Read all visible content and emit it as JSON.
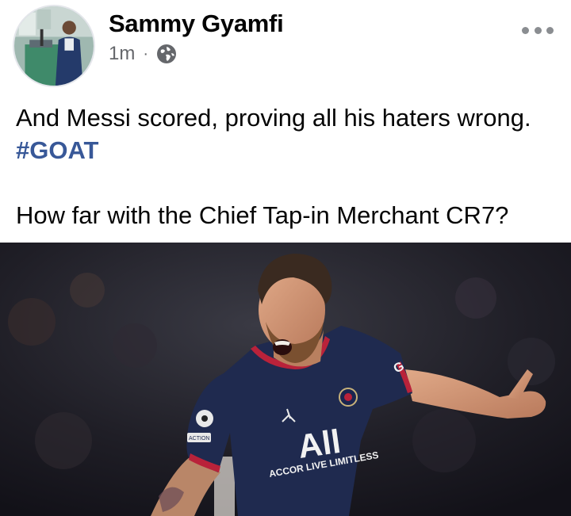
{
  "post": {
    "author": "Sammy Gyamfi",
    "timestamp": "1m",
    "separator": "·",
    "visibility_icon": "globe-icon",
    "more_icon": "more-dots-icon",
    "text_line1_prefix": "And Messi scored, proving all his haters wrong. ",
    "hashtag": "#GOAT",
    "text_paragraph2": "How far with the Chief Tap-in Merchant CR7?",
    "image": {
      "jersey_text": "All",
      "sponsor_text": "ACCOR LIVE LIMITLESS",
      "sleeve_letter": "G",
      "patch_text": "ACTION"
    }
  },
  "colors": {
    "text": "#050505",
    "meta": "#65676b",
    "hashtag": "#385898",
    "jersey": "#1f2a4f",
    "jersey_trim": "#b9223a"
  }
}
